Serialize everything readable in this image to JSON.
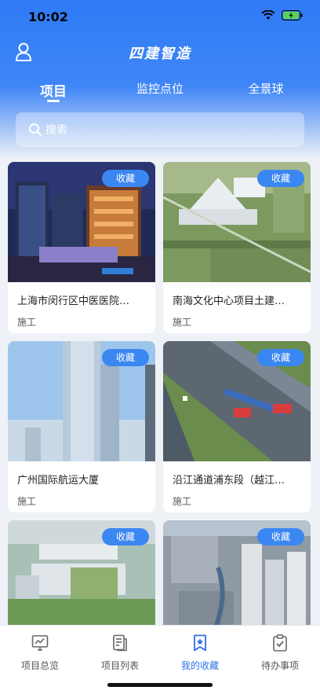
{
  "status_bar": {
    "time": "10:02"
  },
  "app": {
    "title": "四建智造"
  },
  "tabs": [
    {
      "label": "项目",
      "active": true
    },
    {
      "label": "监控点位",
      "active": false
    },
    {
      "label": "全景球",
      "active": false
    }
  ],
  "search": {
    "placeholder": "搜索"
  },
  "projects": [
    {
      "title": "上海市闵行区中医医院…",
      "status": "施工",
      "favorite_label": "收藏"
    },
    {
      "title": "南海文化中心项目土建…",
      "status": "施工",
      "favorite_label": "收藏"
    },
    {
      "title": "广州国际航运大厦",
      "status": "施工",
      "favorite_label": "收藏"
    },
    {
      "title": "沿江通道浦东段（越江…",
      "status": "施工",
      "favorite_label": "收藏"
    },
    {
      "title": "",
      "status": "",
      "favorite_label": "收藏"
    },
    {
      "title": "",
      "status": "",
      "favorite_label": "收藏"
    }
  ],
  "tabbar": [
    {
      "label": "项目总览",
      "icon": "chart-monitor-icon",
      "active": false
    },
    {
      "label": "项目列表",
      "icon": "document-list-icon",
      "active": false
    },
    {
      "label": "我的收藏",
      "icon": "bookmark-star-icon",
      "active": true
    },
    {
      "label": "待办事项",
      "icon": "clipboard-check-icon",
      "active": false
    }
  ],
  "colors": {
    "primary": "#2f7bf6",
    "accent": "#3b87f2",
    "active_tab": "#2f6fe8"
  }
}
